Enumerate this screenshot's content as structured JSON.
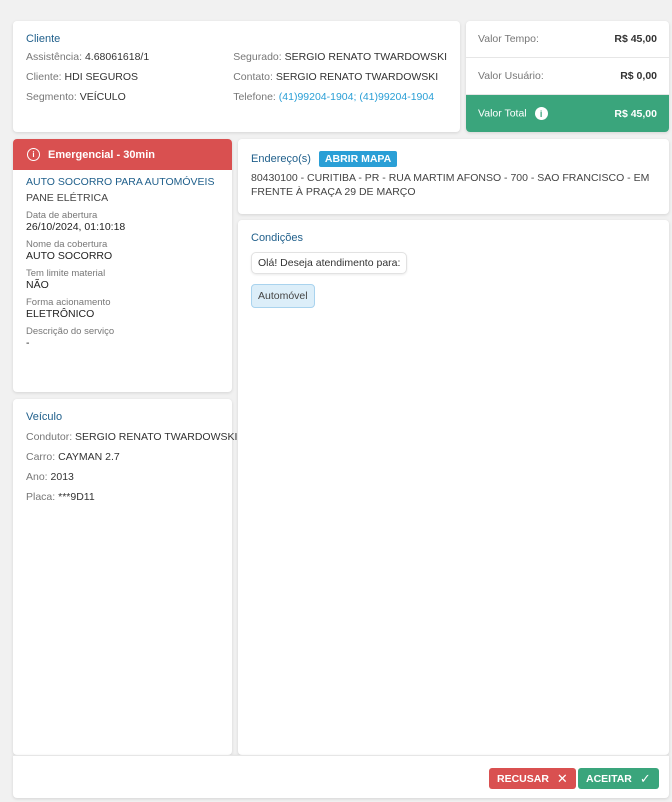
{
  "client": {
    "title": "Cliente",
    "left": [
      {
        "label": "Assistência:",
        "value": "4.68061618/1"
      },
      {
        "label": "Cliente:",
        "value": "HDI SEGUROS"
      },
      {
        "label": "Segmento:",
        "value": "VEÍCULO"
      }
    ],
    "right": [
      {
        "label": "Segurado:",
        "value": "SERGIO RENATO TWARDOWSKI"
      },
      {
        "label": "Contato:",
        "value": "SERGIO RENATO TWARDOWSKI"
      },
      {
        "label": "Telefone:",
        "value": "(41)99204-1904; (41)99204-1904"
      }
    ]
  },
  "values": {
    "tempo_label": "Valor Tempo:",
    "tempo": "R$ 45,00",
    "usuario_label": "Valor Usuário:",
    "usuario": "R$ 0,00",
    "total_label": "Valor Total",
    "total": "R$ 45,00",
    "colors": {
      "total_bg": "#3aa57c"
    }
  },
  "service": {
    "badge": "Emergencial - 30min",
    "badge_color": "#d95050",
    "name": "AUTO SOCORRO PARA AUTOMÓVEIS",
    "problem": "PANE ELÉTRICA",
    "fields": [
      {
        "label": "Data de abertura",
        "value": "26/10/2024, 01:10:18"
      },
      {
        "label": "Nome da cobertura",
        "value": "AUTO SOCORRO"
      },
      {
        "label": "Tem limite material",
        "value": "NÃO"
      },
      {
        "label": "Forma acionamento",
        "value": "ELETRÔNICO"
      },
      {
        "label": "Descrição do serviço",
        "value": "-"
      }
    ]
  },
  "vehicle": {
    "title": "Veículo",
    "rows": [
      {
        "label": "Condutor:",
        "value": "SERGIO RENATO TWARDOWSKI"
      },
      {
        "label": "Carro:",
        "value": "CAYMAN 2.7"
      },
      {
        "label": "Ano:",
        "value": "2013"
      },
      {
        "label": "Placa:",
        "value": "***9D11"
      }
    ]
  },
  "address": {
    "title": "Endereço(s)",
    "map_button": "ABRIR MAPA",
    "text": "80430100 - CURITIBA - PR - RUA MARTIM AFONSO - 700 - SAO FRANCISCO - EM FRENTE À PRAÇA 29 DE MARÇO"
  },
  "conditions": {
    "title": "Condições",
    "question": "Olá! Deseja atendimento para:",
    "answer": "Automóvel"
  },
  "footer": {
    "reject": "RECUSAR",
    "accept": "ACEITAR"
  }
}
